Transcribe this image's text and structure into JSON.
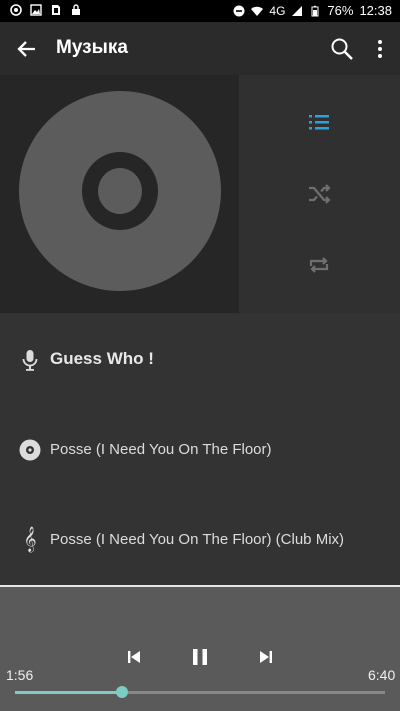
{
  "status_bar": {
    "network": "4G",
    "battery": "76%",
    "time": "12:38",
    "left_icons": [
      "record-icon",
      "image-icon",
      "sim-icon",
      "lock-icon"
    ],
    "right_icons": [
      "dnd-icon",
      "wifi-icon",
      "signal-icon",
      "battery-icon"
    ]
  },
  "toolbar": {
    "title": "Музыка",
    "back_icon": "arrow-left-icon",
    "search_icon": "search-icon",
    "more_icon": "more-vert-icon"
  },
  "side_controls": {
    "queue_icon": "queue-list-icon",
    "shuffle_icon": "shuffle-icon",
    "repeat_icon": "repeat-icon",
    "accent_color": "#29a3db"
  },
  "track": {
    "artist": "Guess Who !",
    "album": "Posse (I Need You On The Floor)",
    "title": "Posse (I Need You On The Floor) (Club Mix)"
  },
  "player": {
    "elapsed": "1:56",
    "duration": "6:40",
    "progress": 0.29,
    "state": "playing",
    "accent_color": "#7ecac4"
  }
}
